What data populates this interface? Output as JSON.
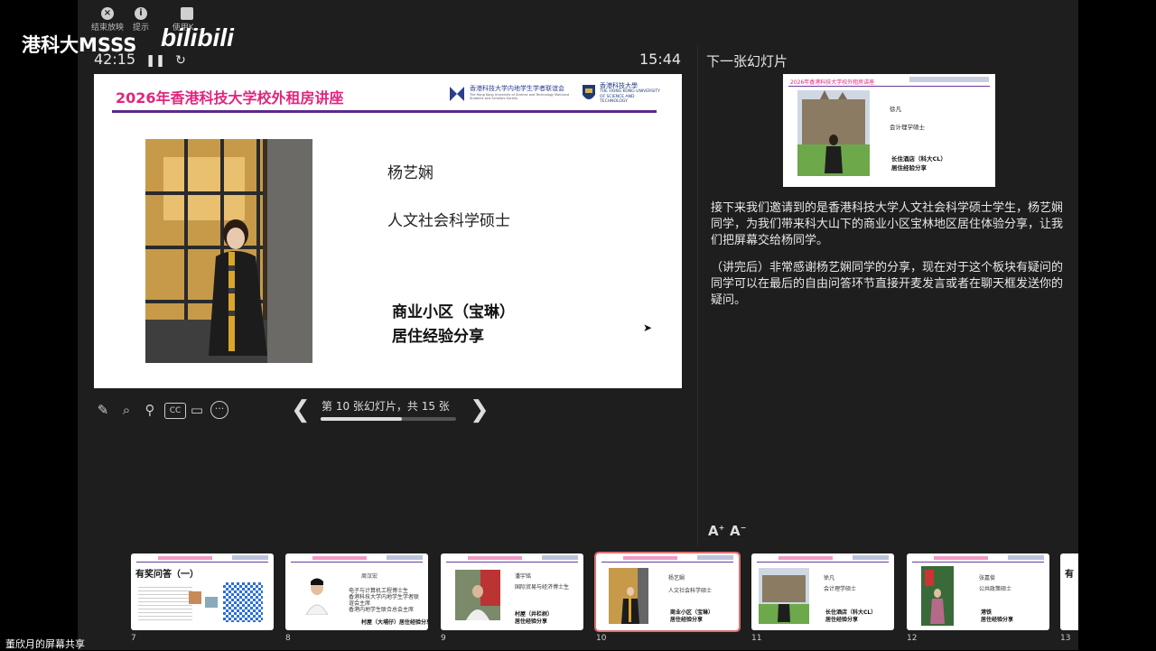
{
  "watermark": {
    "channel": "港科大MSSS",
    "platform": "bilibili"
  },
  "toolbar": {
    "end_show": "结束放映",
    "hint": "提示",
    "use_label": "使用K...",
    "end_icon": "close-circle-icon",
    "hint_icon": "info-icon",
    "use_icon": "window-icon"
  },
  "presenter": {
    "elapsed_time": "42:15",
    "clock": "15:44",
    "next_slide_heading": "下一张幻灯片"
  },
  "current_slide": {
    "title": "2026年香港科技大学校外租房讲座",
    "org_name": "香港科技大学内地学生学者联谊会",
    "org_name_en": "The Hong Kong University of Science and Technology Mainland Students and Scholars Society",
    "univ_cn": "香港科技大學",
    "univ_en": "THE HONG KONG UNIVERSITY OF SCIENCE AND TECHNOLOGY",
    "speaker_name": "杨艺娴",
    "speaker_degree": "人文社会科学硕士",
    "topic_line1": "商业小区（宝琳）",
    "topic_line2": "居住经验分享"
  },
  "navigation": {
    "counter": "第 10 张幻灯片，共 15 张",
    "current": 10,
    "total": 15,
    "progress": 0.6
  },
  "next_slide": {
    "title": "2026年香港科技大学校外租房讲座",
    "speaker_name": "徐凡",
    "speaker_degree": "会计理学硕士",
    "topic_line1": "长住酒店（科大CL）",
    "topic_line2": "居住经验分享"
  },
  "notes": {
    "paragraph1": "接下来我们邀请到的是香港科技大学人文社会科学硕士学生，杨艺娴同学，为我们带来科大山下的商业小区宝林地区居住体验分享，让我们把屏幕交给杨同学。",
    "paragraph2": "（讲完后）非常感谢杨艺娴同学的分享，现在对于这个板块有疑问的同学可以在最后的自由问答环节直接开麦发言或者在聊天框发送你的疑问。"
  },
  "font_controls": {
    "increase": "A",
    "decrease": "A"
  },
  "thumbnails": [
    {
      "num": "7",
      "heading": "有奖问答（一）"
    },
    {
      "num": "8",
      "name": "周汉宏",
      "line1": "电子与计算机工程博士生",
      "line2": "香港科技大学内地学生学者联",
      "line3": "谊会主席",
      "line4": "香港内地学生联合总会主席",
      "topic": "村屋（大埔仔）居住经验分享"
    },
    {
      "num": "9",
      "name": "潘宇铭",
      "line1": "国际贸易与经济博士生",
      "topic1": "村屋（井栏树）",
      "topic2": "居住经验分享"
    },
    {
      "num": "10",
      "name": "杨艺娴",
      "line1": "人文社会科学硕士",
      "topic1": "商业小区（宝琳）",
      "topic2": "居住经验分享"
    },
    {
      "num": "11",
      "name": "徐凡",
      "line1": "会计理学硕士",
      "topic1": "长住酒店（科大CL）",
      "topic2": "居住经验分享"
    },
    {
      "num": "12",
      "name": "张嘉俊",
      "line1": "公共政策硕士",
      "topic1": "港铁",
      "topic2": "居住经验分享"
    },
    {
      "num": "13",
      "heading": "有"
    }
  ],
  "share_label": "董欣月的屏幕共享"
}
